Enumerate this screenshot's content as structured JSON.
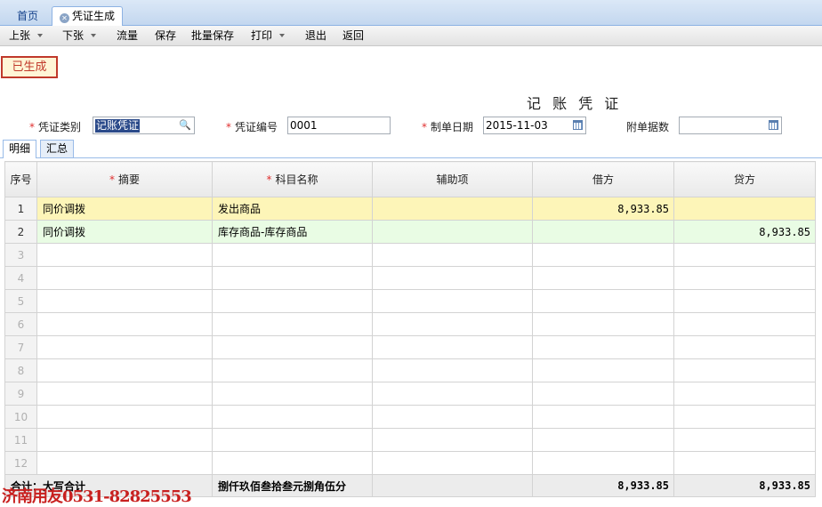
{
  "tabs": [
    {
      "label": "首页",
      "active": false
    },
    {
      "label": "凭证生成",
      "active": true
    }
  ],
  "toolbar": {
    "prev": "上张",
    "next": "下张",
    "flow": "流量",
    "save": "保存",
    "batch_save": "批量保存",
    "print": "打印",
    "exit": "退出",
    "back": "返回"
  },
  "status_badge": "已生成",
  "voucher_title": "记 账 凭 证",
  "fields": {
    "type_label": "凭证类别",
    "type_value": "记账凭证",
    "number_label": "凭证编号",
    "number_value": "0001",
    "date_label": "制单日期",
    "date_value": "2015-11-03",
    "attach_label": "附单据数",
    "attach_value": ""
  },
  "subtabs": [
    "明细",
    "汇总"
  ],
  "grid": {
    "headers": {
      "seq": "序号",
      "summary": "摘要",
      "account": "科目名称",
      "aux": "辅助项",
      "debit": "借方",
      "credit": "贷方"
    },
    "rows": [
      {
        "seq": "1",
        "summary": "同价调拨",
        "account": "发出商品",
        "aux": "",
        "debit": "8,933.85",
        "credit": ""
      },
      {
        "seq": "2",
        "summary": "同价调拨",
        "account": "库存商品-库存商品",
        "aux": "",
        "debit": "",
        "credit": "8,933.85"
      },
      {
        "seq": "3"
      },
      {
        "seq": "4"
      },
      {
        "seq": "5"
      },
      {
        "seq": "6"
      },
      {
        "seq": "7"
      },
      {
        "seq": "8"
      },
      {
        "seq": "9"
      },
      {
        "seq": "10"
      },
      {
        "seq": "11"
      },
      {
        "seq": "12"
      }
    ],
    "total": {
      "label": "合计：大写合计",
      "amount_words": "捌仟玖佰叁拾叁元捌角伍分",
      "debit": "8,933.85",
      "credit": "8,933.85"
    }
  },
  "watermark": "济南用友0531-82825553",
  "colors": {
    "required": "#e03030",
    "badge": "#c0392b",
    "row1": "#fdf5b8",
    "row2": "#e9fce4"
  }
}
